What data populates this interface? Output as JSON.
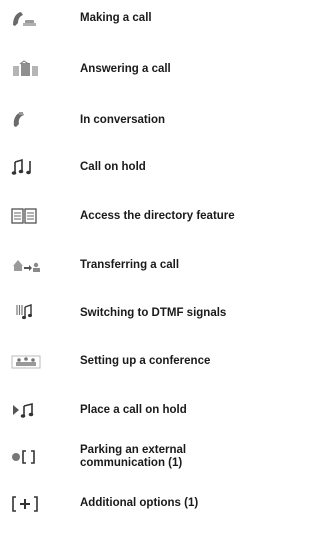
{
  "items": [
    {
      "icon": "handset-lifting-icon",
      "label": "Making a call"
    },
    {
      "icon": "answering-call-icon",
      "label": "Answering a call"
    },
    {
      "icon": "handset-conversation-icon",
      "label": "In conversation"
    },
    {
      "icon": "music-notes-hold-icon",
      "label": "Call on hold"
    },
    {
      "icon": "directory-book-icon",
      "label": "Access the directory feature"
    },
    {
      "icon": "transfer-call-icon",
      "label": "Transferring a call"
    },
    {
      "icon": "dtmf-keypad-icon",
      "label": "Switching to DTMF signals"
    },
    {
      "icon": "conference-icon",
      "label": "Setting up a conference"
    },
    {
      "icon": "place-on-hold-icon",
      "label": "Place a call on hold"
    },
    {
      "icon": "parking-icon",
      "label": "Parking an external communication  (1)"
    },
    {
      "icon": "additional-options-icon",
      "label": "Additional options (1)"
    }
  ]
}
